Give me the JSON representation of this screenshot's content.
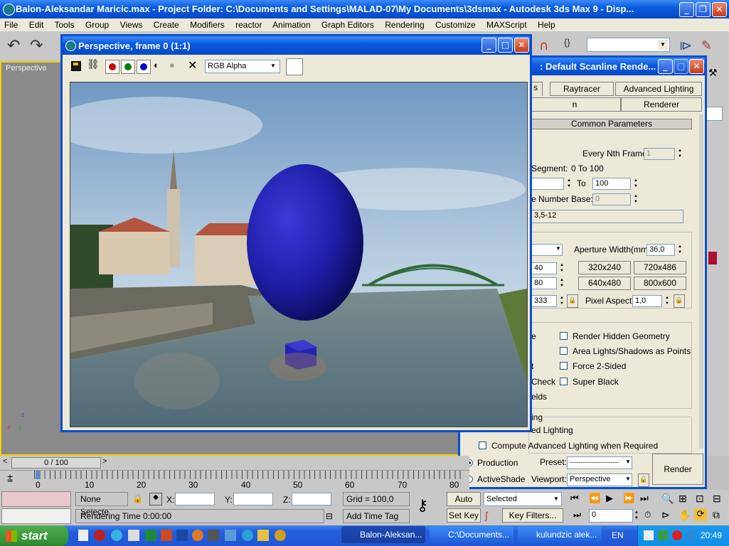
{
  "app": {
    "title": "Balon-Aleksandar Maricic.max     - Project Folder: C:\\Documents and Settings\\MALAD-07\\My Documents\\3dsmax     - Autodesk 3ds Max 9     - Disp..."
  },
  "menu": [
    "File",
    "Edit",
    "Tools",
    "Group",
    "Views",
    "Create",
    "Modifiers",
    "reactor",
    "Animation",
    "Graph Editors",
    "Rendering",
    "Customize",
    "MAXScript",
    "Help"
  ],
  "viewport": {
    "label": "Perspective"
  },
  "render_window": {
    "title": "Perspective, frame 0 (1:1)",
    "channel": "RGB Alpha",
    "colors": {
      "red": "#cc0000",
      "green": "#008000",
      "blue": "#0000cc"
    }
  },
  "render_dialog": {
    "title": ": Default Scanline Rende...",
    "tabs_top": [
      "s",
      "Raytracer",
      "Advanced Lighting"
    ],
    "tabs_bottom": [
      "n",
      "Renderer"
    ],
    "rollout": "Common Parameters",
    "every_nth_label": "Every Nth Frame:",
    "every_nth_value": "1",
    "segment_label": "Segment:",
    "segment_value": "0 To 100",
    "to_label": "To",
    "to_value": "100",
    "number_base_label": "e Number Base:",
    "number_base_value": "0",
    "frames_value": "3,5-12",
    "aperture_label": "Aperture Width(mm):",
    "aperture_value": "36,0",
    "width_value": "40",
    "height_value": "80",
    "aspect_value": "333",
    "res_buttons": [
      "320x240",
      "720x486",
      "640x480",
      "800x600"
    ],
    "pixel_aspect_label": "Pixel Aspect:",
    "pixel_aspect_value": "1,0",
    "options_left": [
      "e",
      "t",
      "Check",
      "elds"
    ],
    "options": [
      "Render Hidden Geometry",
      "Area Lights/Shadows as Points",
      "Force 2-Sided",
      "Super Black"
    ],
    "adv_group_label": "ing",
    "adv_use": "ed Lighting",
    "adv_compute": "Compute Advanced Lighting when Required",
    "production": "Production",
    "activeshade": "ActiveShade",
    "preset_label": "Preset:",
    "preset_value": "-----------------------",
    "viewport_label": "Viewport:",
    "viewport_value": "Perspective",
    "render_button": "Render"
  },
  "timeline": {
    "frame": "0 / 100",
    "ticks": [
      "0",
      "10",
      "20",
      "30",
      "40",
      "50",
      "60",
      "70",
      "80"
    ]
  },
  "status": {
    "selection": "None Selecte",
    "x_label": "X:",
    "y_label": "Y:",
    "z_label": "Z:",
    "grid": "Grid = 100,0",
    "rendering_time": "Rendering Time  0:00:00",
    "add_time_tag": "Add Time Tag",
    "auto_key": "Auto Key",
    "set_key": "Set Key",
    "selected": "Selected",
    "key_filters": "Key Filters...",
    "frame_value": "0"
  },
  "taskbar": {
    "start": "start",
    "tasks": [
      "Balon-Aleksan...",
      "C:\\Documents...",
      "kulundzic alek..."
    ],
    "lang": "EN",
    "clock": "20:49"
  }
}
